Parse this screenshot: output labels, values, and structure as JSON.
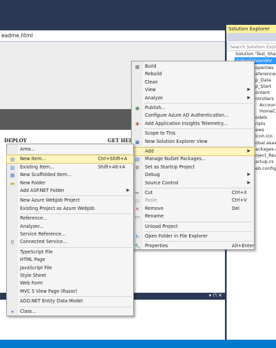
{
  "document": {
    "tab_title": "eadme.html",
    "deploy": "DEPLOY",
    "get_help": "GET HELP"
  },
  "solution_explorer": {
    "title": "Solution Explorer",
    "search_placeholder": "Search Solution Explore",
    "tree": [
      "Solution 'Test_Sha",
      "SchoolVisionMV",
      "operties",
      "eferences",
      "p_Data",
      "p_Start",
      "ontent",
      "ntrollers",
      "Account",
      "HomeCo",
      "odels",
      "ripts",
      "ews",
      "icon.ico",
      "obal.asax",
      "ackages.con",
      "oject_Rea",
      "artup.cs",
      "eb.config"
    ]
  },
  "context_menu": [
    {
      "label": "Build"
    },
    {
      "label": "Rebuild"
    },
    {
      "label": "Clean"
    },
    {
      "label": "View",
      "submenu": true
    },
    {
      "label": "Analyze",
      "submenu": true
    },
    {
      "label": "Publish..."
    },
    {
      "label": "Configure Azure AD Authentication..."
    },
    {
      "label": "Add Application Insights Telemetry..."
    },
    {
      "label": "Scope to This"
    },
    {
      "label": "New Solution Explorer View"
    },
    {
      "label": "Add",
      "submenu": true
    },
    {
      "label": "Manage NuGet Packages..."
    },
    {
      "label": "Set as StartUp Project"
    },
    {
      "label": "Debug",
      "submenu": true
    },
    {
      "label": "Source Control",
      "submenu": true
    },
    {
      "label": "Cut",
      "shortcut": "Ctrl+X"
    },
    {
      "label": "Paste",
      "shortcut": "Ctrl+V"
    },
    {
      "label": "Remove",
      "shortcut": "Del"
    },
    {
      "label": "Rename"
    },
    {
      "label": "Unload Project"
    },
    {
      "label": "Open Folder in File Explorer"
    },
    {
      "label": "Properties",
      "shortcut": "Alt+Enter"
    }
  ],
  "add_submenu": [
    {
      "label": "Area..."
    },
    {
      "label": "New Item...",
      "shortcut": "Ctrl+Shift+A"
    },
    {
      "label": "Existing Item...",
      "shortcut": "Shift+Alt+A"
    },
    {
      "label": "New Scaffolded Item..."
    },
    {
      "label": "New Folder"
    },
    {
      "label": "Add ASP.NET Folder",
      "submenu": true
    },
    {
      "label": "New Azure WebJob Project"
    },
    {
      "label": "Existing Project as Azure WebJob"
    },
    {
      "label": "Reference..."
    },
    {
      "label": "Analyzer..."
    },
    {
      "label": "Service Reference..."
    },
    {
      "label": "Connected Service..."
    },
    {
      "label": "TypeScript File"
    },
    {
      "label": "HTML Page"
    },
    {
      "label": "JavaScript File"
    },
    {
      "label": "Style Sheet"
    },
    {
      "label": "Web Form"
    },
    {
      "label": "MVC 5 View Page (Razor)"
    },
    {
      "label": "ADO.NET Entity Data Model"
    },
    {
      "label": "Class..."
    }
  ],
  "bottom_panel": {
    "pin": "▾ ⊓ ✕"
  }
}
